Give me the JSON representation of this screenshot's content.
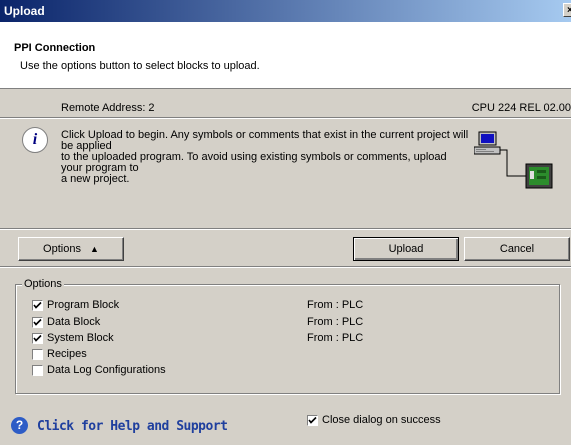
{
  "window": {
    "title": "Upload",
    "close_glyph": "×"
  },
  "header": {
    "title": "PPI Connection",
    "subtitle": "Use the options button to select blocks to upload."
  },
  "connection": {
    "remote_address": "Remote Address: 2",
    "cpu": "CPU 224 REL 02.00"
  },
  "info": {
    "icon": "info-icon",
    "glyph": "i",
    "lines": [
      "Click Upload to begin. Any symbols or comments that exist in the current project will be applied",
      "to the uploaded program.  To avoid using existing symbols or comments, upload your program to",
      "a new project."
    ]
  },
  "buttons": {
    "options": "Options",
    "options_glyph": "▲",
    "upload": "Upload",
    "cancel": "Cancel"
  },
  "options": {
    "legend": "Options",
    "items": [
      {
        "label": "Program Block",
        "checked": true,
        "from": "From : PLC"
      },
      {
        "label": "Data Block",
        "checked": true,
        "from": "From : PLC"
      },
      {
        "label": "System Block",
        "checked": true,
        "from": "From : PLC"
      },
      {
        "label": "Recipes",
        "checked": false,
        "from": ""
      },
      {
        "label": "Data Log Configurations",
        "checked": false,
        "from": ""
      }
    ]
  },
  "footer": {
    "help_glyph": "?",
    "help_label": "Click for Help and Support",
    "close_on_success": {
      "label": "Close dialog on success",
      "checked": true
    }
  },
  "colors": {
    "title_start": "#0a246a",
    "title_end": "#a6caf0",
    "dialog_face": "#d4d0c8",
    "help_link": "#1f3f9e"
  }
}
